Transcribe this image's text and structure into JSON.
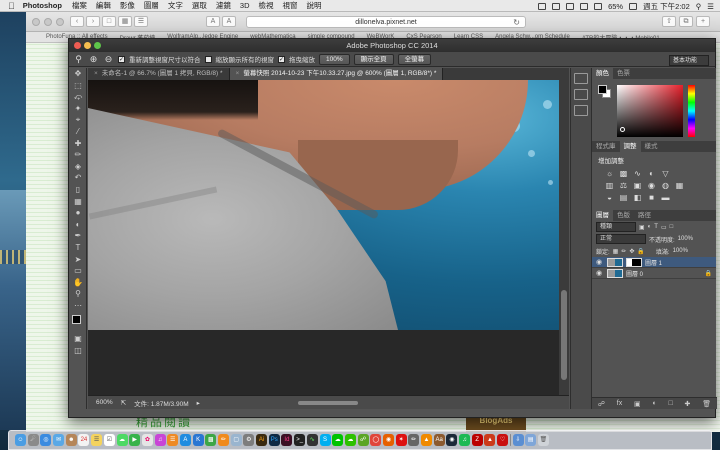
{
  "menubar": {
    "app_name": "Photoshop",
    "items": [
      "檔案",
      "編輯",
      "影像",
      "圖層",
      "文字",
      "選取",
      "濾鏡",
      "3D",
      "檢視",
      "視窗",
      "說明"
    ],
    "battery": "65%",
    "clock": "週五 下午2:02"
  },
  "safari": {
    "url": "dillonelva.pixnet.net",
    "font_small": "A",
    "font_large": "A",
    "bookmarks": [
      "PhotoFuna :: All effects",
      "Drawr 蕃茄繪",
      "WolframAlp...ledge Engine",
      "webMathematica",
      "simple compound",
      "WeBWorK",
      "CxS Pearson",
      "Learn CSS",
      "Angela Schw...om Schedule",
      "ATR的大冒險・・・Mobile01"
    ],
    "badge_text": "BlogAds",
    "green_text": "精品閱讀"
  },
  "photoshop": {
    "window_title": "Adobe Photoshop CC 2014",
    "options": {
      "resize_label": "重新調整視窗尺寸以符合",
      "zoom_all_label": "縮放顯示所有的視窗",
      "scrubby_label": "拖曳縮放",
      "zoom_100": "100%",
      "fit_screen": "顯示全頁",
      "fill_screen": "全螢幕",
      "workspace": "基本功能"
    },
    "tabs": [
      {
        "label": "未命名-1 @ 66.7% (圖層 1 拷貝, RGB/8) *",
        "active": false
      },
      {
        "label": "螢幕快照 2014-10-23 下午10.33.27.jpg @ 600% (圖層 1, RGB/8*) *",
        "active": true
      }
    ],
    "status": {
      "zoom": "600%",
      "doc_size": "文件: 1.87M/3.90M"
    },
    "panels": {
      "color_tabs": [
        "顏色",
        "色票"
      ],
      "adjust_tabs": [
        "程式庫",
        "調整",
        "樣式"
      ],
      "adjust_title": "增加調整",
      "layer_tabs": [
        "圖層",
        "色版",
        "路徑"
      ],
      "kind_filter": "種類",
      "blend_mode": "正常",
      "opacity_label": "不透明度:",
      "opacity_value": "100%",
      "lock_label": "鎖定:",
      "fill_label": "填滿:",
      "fill_value": "100%",
      "layers": [
        {
          "name": "圖層 1",
          "selected": true
        },
        {
          "name": "圖層 0",
          "selected": false
        }
      ]
    }
  },
  "colors": {
    "ps_dark": "#535353",
    "selection_blue": "#3e5a7e",
    "close_red": "#ee5c52",
    "min_yellow": "#f5be4f",
    "max_green": "#5ec44a"
  }
}
